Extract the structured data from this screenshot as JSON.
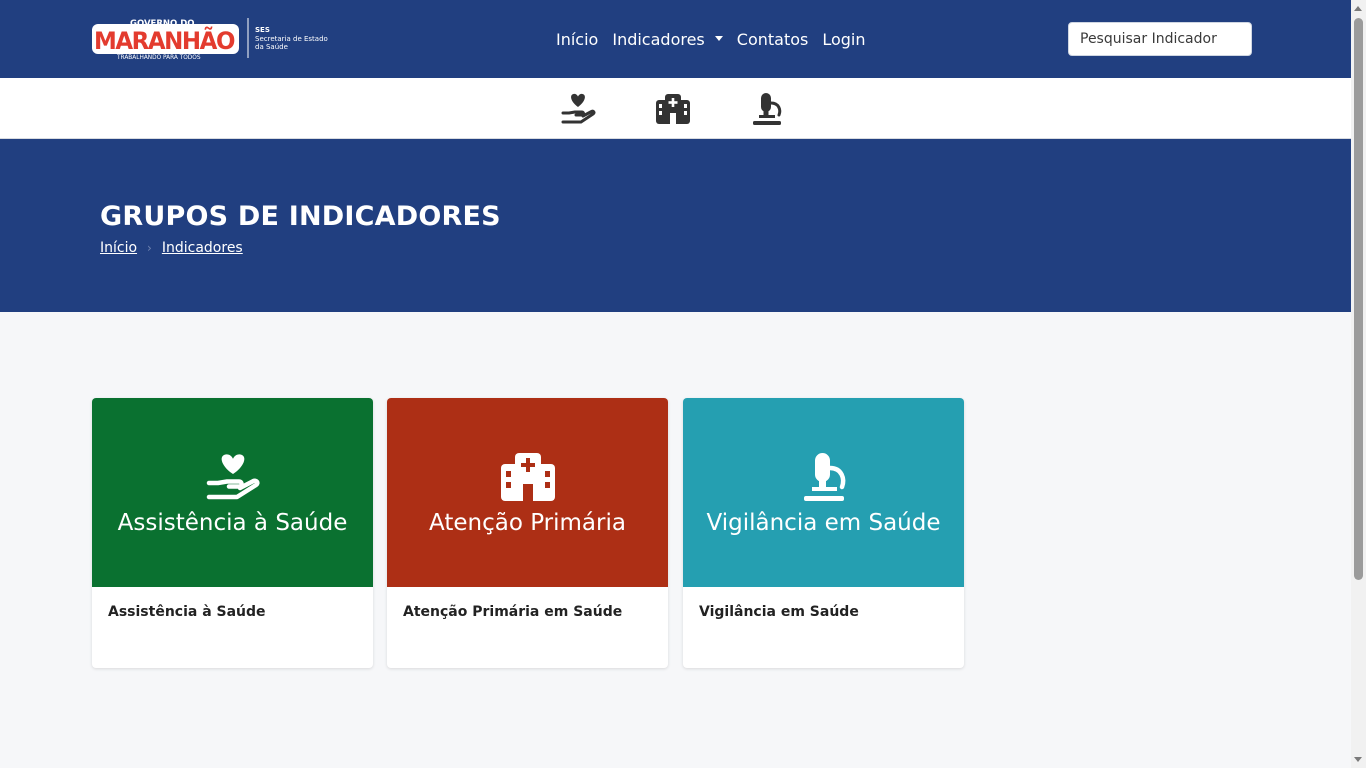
{
  "header": {
    "logo": {
      "line1": "GOVERNO DO",
      "brand": "MARANHÃO",
      "tagline": "TRABALHANDO PARA TODOS",
      "agency_abbr": "SES",
      "agency_line1": "Secretaria de Estado",
      "agency_line2": "da Saúde"
    },
    "nav": [
      {
        "label": "Início"
      },
      {
        "label": "Indicadores"
      },
      {
        "label": "Contatos"
      },
      {
        "label": "Login"
      }
    ],
    "search": {
      "placeholder": "Pesquisar Indicador"
    }
  },
  "icon_bar": [
    {
      "icon": "hand-holding-heart-icon"
    },
    {
      "icon": "hospital-icon"
    },
    {
      "icon": "microscope-icon"
    }
  ],
  "banner": {
    "title": "GRUPOS DE INDICADORES",
    "breadcrumb": [
      "Início",
      "Indicadores"
    ]
  },
  "cards": [
    {
      "title": "Assistência à Saúde",
      "description": "Assistência à Saúde",
      "color": "#0a7130",
      "icon": "hand-holding-heart-icon"
    },
    {
      "title": "Atenção Primária",
      "description": "Atenção Primária em Saúde",
      "color": "#ad2f15",
      "icon": "hospital-icon"
    },
    {
      "title": "Vigilância em Saúde",
      "description": "Vigilância em Saúde",
      "color": "#259fb1",
      "icon": "microscope-icon"
    }
  ],
  "colors": {
    "header_bg": "#213f80",
    "page_bg": "#f6f7f9",
    "icon_bar_icons": "#333333"
  }
}
